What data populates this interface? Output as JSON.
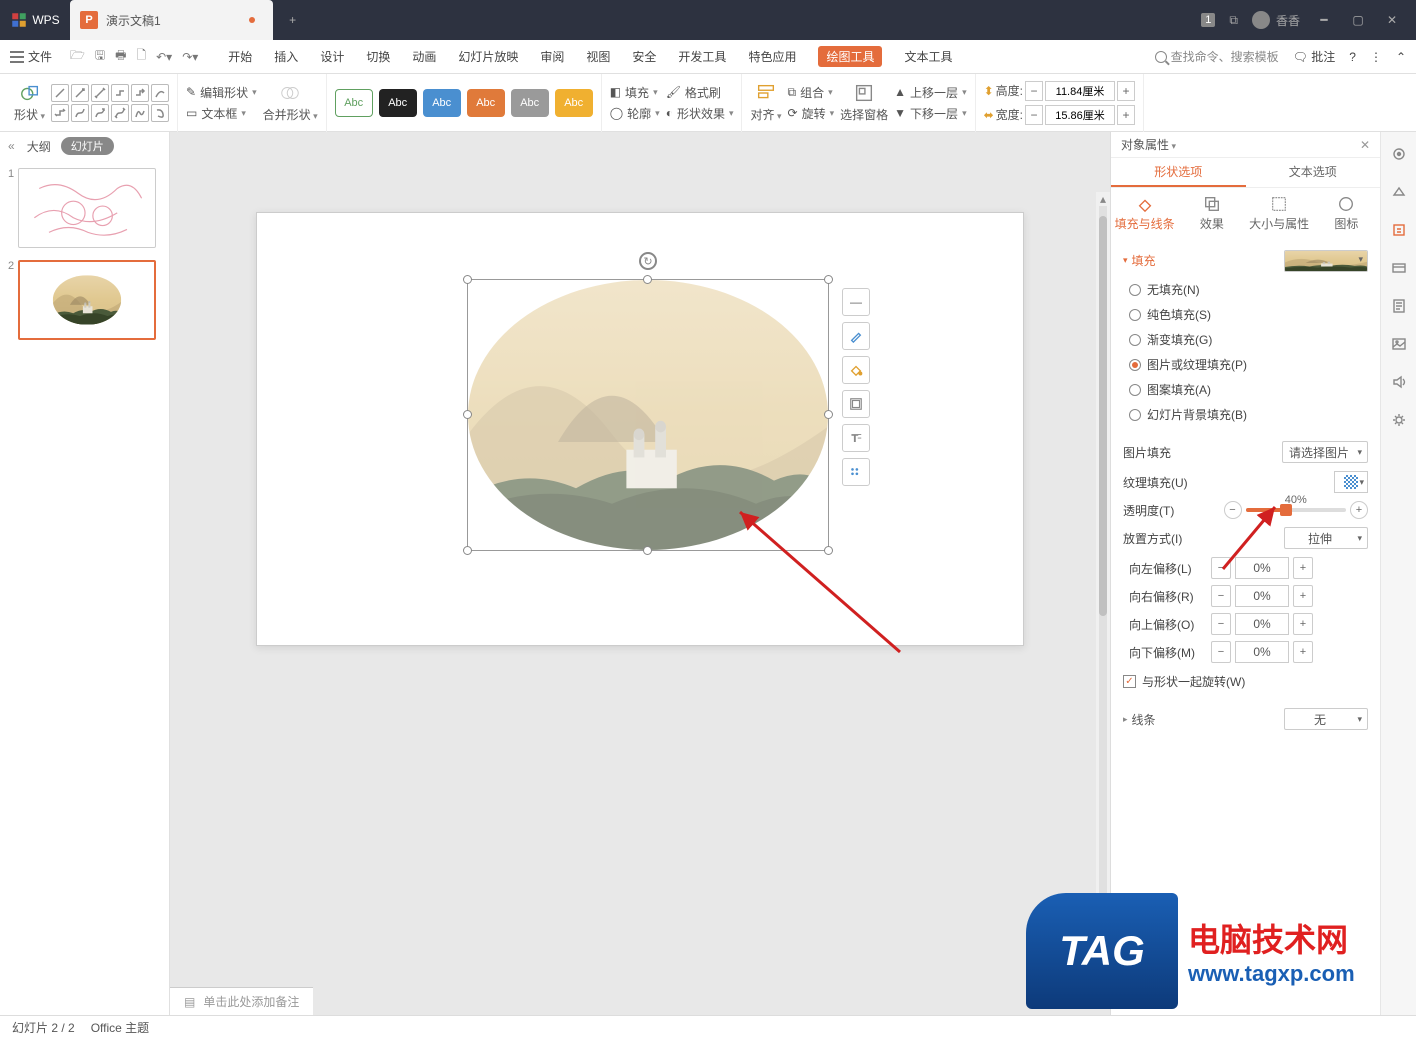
{
  "title_bar": {
    "wps_label": "WPS",
    "doc_title": "演示文稿1",
    "new_tab": "+",
    "badge": "1",
    "user_name": "香香"
  },
  "menu": {
    "file": "文件",
    "tabs": [
      "开始",
      "插入",
      "设计",
      "切换",
      "动画",
      "幻灯片放映",
      "审阅",
      "视图",
      "安全",
      "开发工具",
      "特色应用",
      "绘图工具",
      "文本工具"
    ],
    "active_index": 11,
    "search_placeholder": "查找命令、搜索模板",
    "annotate": "批注"
  },
  "ribbon": {
    "shape_label": "形状",
    "edit_shape": "编辑形状",
    "text_box": "文本框",
    "merge_shapes": "合并形状",
    "swatch_text": "Abc",
    "fill": "填充",
    "outline": "轮廓",
    "format_painter": "格式刷",
    "shape_effect": "形状效果",
    "align": "对齐",
    "group": "组合",
    "rotate": "旋转",
    "select_pane": "选择窗格",
    "bring_fwd": "上移一层",
    "send_back": "下移一层",
    "height_label": "高度:",
    "width_label": "宽度:",
    "height_value": "11.84厘米",
    "width_value": "15.86厘米"
  },
  "outline": {
    "tab_outline": "大纲",
    "tab_slides": "幻灯片",
    "thumb_count": 2
  },
  "notes_placeholder": "单击此处添加备注",
  "prop_pane": {
    "title": "对象属性",
    "tab_shape": "形状选项",
    "tab_text": "文本选项",
    "sub_fill": "填充与线条",
    "sub_effect": "效果",
    "sub_size": "大小与属性",
    "sub_icon": "图标",
    "fill_section": "填充",
    "fill_options": {
      "none": "无填充(N)",
      "solid": "纯色填充(S)",
      "gradient": "渐变填充(G)",
      "picture": "图片或纹理填充(P)",
      "pattern": "图案填充(A)",
      "slide_bg": "幻灯片背景填充(B)"
    },
    "pic_fill_label": "图片填充",
    "pic_fill_value": "请选择图片",
    "texture_label": "纹理填充(U)",
    "transparency_label": "透明度(T)",
    "transparency_value": "40%",
    "transparency_pct": 40,
    "placement_label": "放置方式(I)",
    "placement_value": "拉伸",
    "offset_left": "向左偏移(L)",
    "offset_right": "向右偏移(R)",
    "offset_top": "向上偏移(O)",
    "offset_bottom": "向下偏移(M)",
    "offset_value": "0%",
    "rotate_with": "与形状一起旋转(W)",
    "line_section": "线条",
    "line_value": "无"
  },
  "status": {
    "slide": "幻灯片 2 / 2",
    "theme": "Office 主题"
  },
  "watermark": {
    "tag": "TAG",
    "cn": "电脑技术网",
    "url": "www.tagxp.com"
  }
}
